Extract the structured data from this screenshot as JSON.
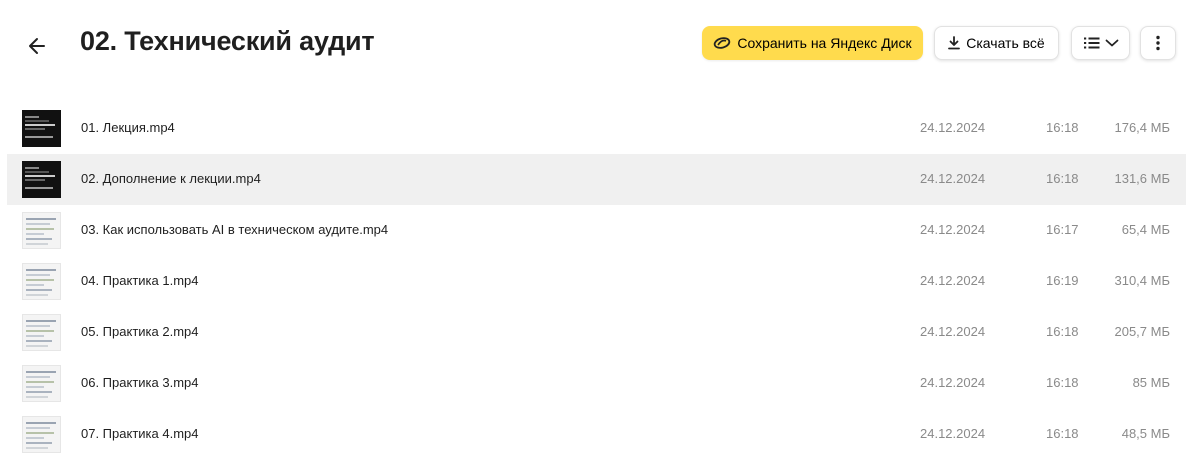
{
  "header": {
    "title": "02. Технический аудит",
    "save_label": "Сохранить на Яндекс Диск",
    "download_label": "Скачать всё",
    "icons": {
      "back": "arrow-left-icon",
      "save": "yandex-disk-icon",
      "download": "download-icon",
      "view": "list-view-icon",
      "view_chevron": "chevron-down-icon",
      "more": "more-vertical-icon"
    }
  },
  "colors": {
    "save_button": "#ffdb4d",
    "selected_row": "#f0f0f0",
    "meta_text": "#8a8a8a"
  },
  "files": [
    {
      "name": "01. Лекция.mp4",
      "date": "24.12.2024",
      "time": "16:18",
      "size": "176,4 МБ",
      "thumb": "dark"
    },
    {
      "name": "02. Дополнение к лекции.mp4",
      "date": "24.12.2024",
      "time": "16:18",
      "size": "131,6 МБ",
      "thumb": "dark"
    },
    {
      "name": "03. Как использовать AI в техническом аудите.mp4",
      "date": "24.12.2024",
      "time": "16:17",
      "size": "65,4 МБ",
      "thumb": "light"
    },
    {
      "name": "04. Практика 1.mp4",
      "date": "24.12.2024",
      "time": "16:19",
      "size": "310,4 МБ",
      "thumb": "light"
    },
    {
      "name": "05. Практика 2.mp4",
      "date": "24.12.2024",
      "time": "16:18",
      "size": "205,7 МБ",
      "thumb": "light"
    },
    {
      "name": "06. Практика 3.mp4",
      "date": "24.12.2024",
      "time": "16:18",
      "size": "85 МБ",
      "thumb": "light"
    },
    {
      "name": "07. Практика 4.mp4",
      "date": "24.12.2024",
      "time": "16:18",
      "size": "48,5 МБ",
      "thumb": "light"
    }
  ]
}
